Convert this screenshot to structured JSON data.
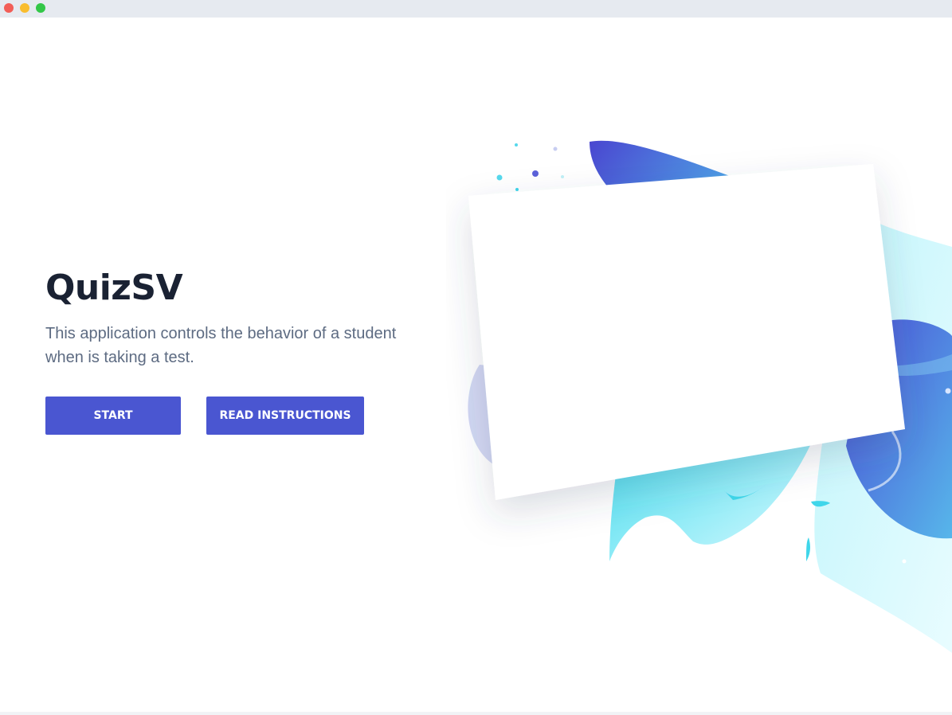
{
  "window": {
    "controls": [
      "close",
      "minimize",
      "maximize"
    ]
  },
  "hero": {
    "title": "QuizSV",
    "description": "This application controls the behavior of a student when is taking a test.",
    "start_label": "START",
    "instructions_label": "READ INSTRUCTIONS"
  },
  "colors": {
    "accent": "#4a56d1",
    "title": "#1a2233",
    "text": "#5d6b82",
    "cyan": "#4fe0ef",
    "blue": "#4b4fd4"
  }
}
